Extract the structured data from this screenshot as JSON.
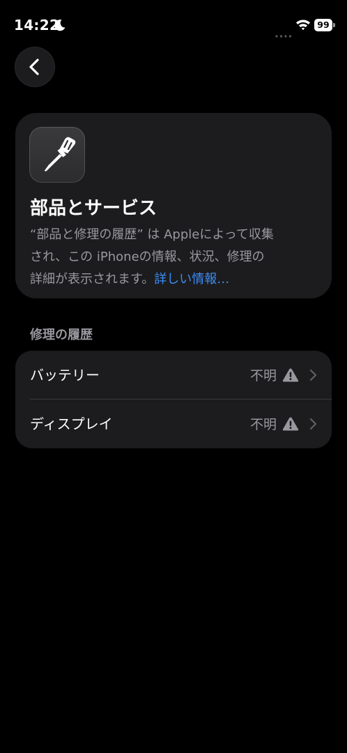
{
  "status_bar": {
    "time": "14:22",
    "battery": "99",
    "icons": [
      "moon-icon",
      "cellular-signal-icon",
      "wifi-icon",
      "battery-icon"
    ]
  },
  "nav": {
    "back_icon": "chevron-left-icon"
  },
  "hero": {
    "icon": "screwdriver-icon",
    "title": "部品とサービス",
    "description_lines": [
      "“部品と修理の履歴” は Appleによって収集",
      "され、この iPhoneの情報、状況、修理の",
      "詳細が表示されます。"
    ],
    "link_text": "詳しい情報…"
  },
  "repair_history": {
    "header": "修理の履歴",
    "items": [
      {
        "label": "バッテリー",
        "value": "不明",
        "status_icon": "warning-icon"
      },
      {
        "label": "ディスプレイ",
        "value": "不明",
        "status_icon": "warning-icon"
      }
    ]
  },
  "colors": {
    "background": "#000000",
    "card": "#1c1c1e",
    "secondary_text": "#98989f",
    "link": "#3b8cf6",
    "divider": "#3a3a3c"
  }
}
